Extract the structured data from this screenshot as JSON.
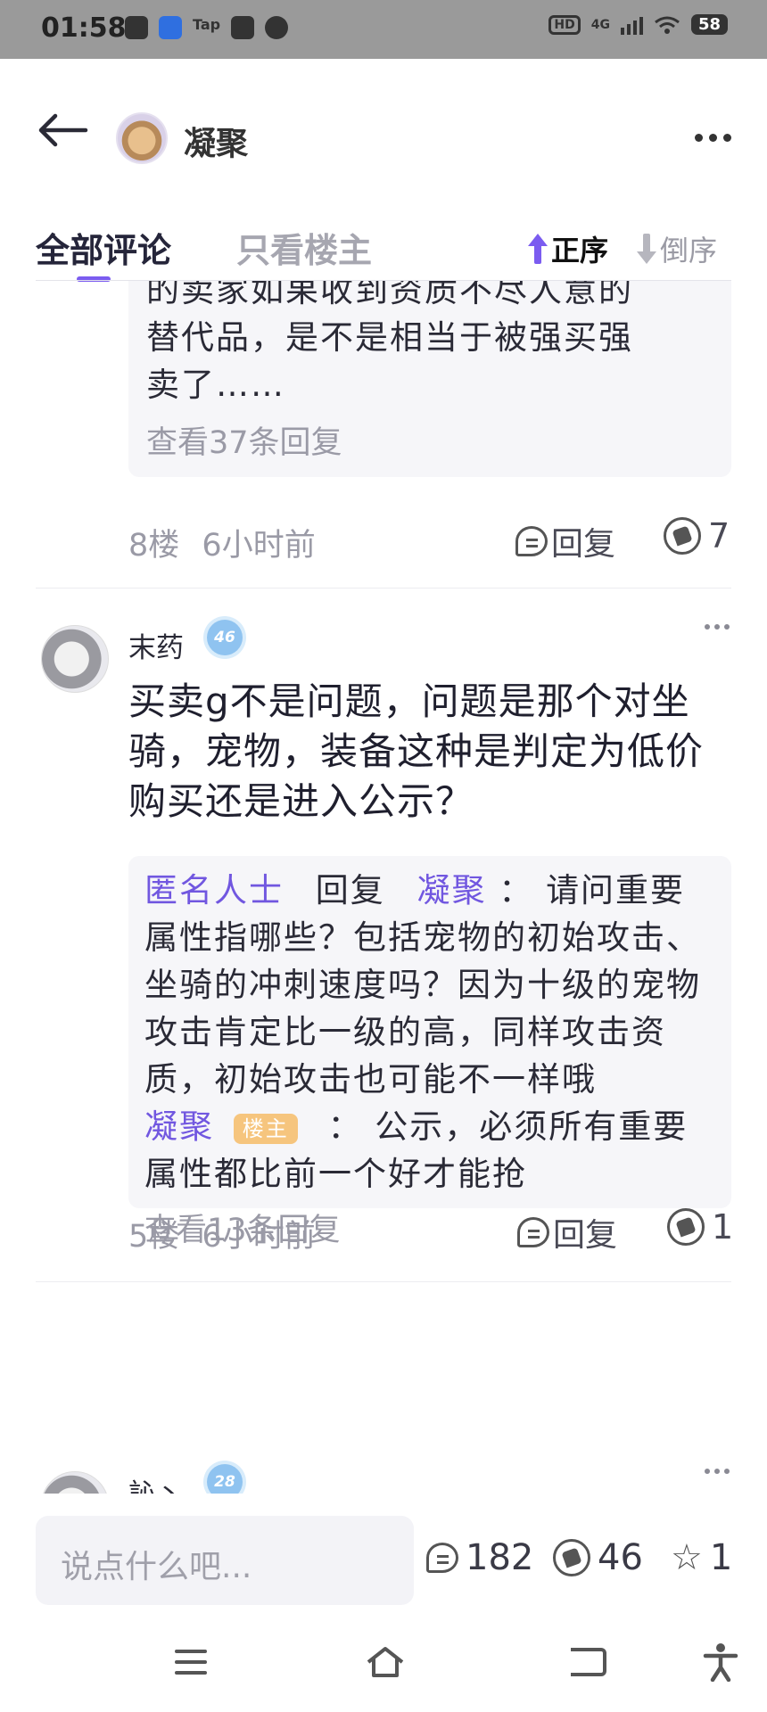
{
  "status_bar": {
    "time": "01:58",
    "tap_label": "Tap",
    "hd_label": "HD",
    "network": "4G",
    "battery": "58"
  },
  "header": {
    "title": "凝聚"
  },
  "tabs": {
    "all": "全部评论",
    "op_only": "只看楼主",
    "sort_asc": "正序",
    "sort_desc": "倒序"
  },
  "floor8": {
    "reply_lines": [
      "的卖家如果收到资质不尽人意的",
      "替代品，是不是相当于被强买强",
      "卖了……"
    ],
    "view_more": "查看37条回复",
    "floor": "8楼",
    "time": "6小时前",
    "reply_label": "回复",
    "likes": "7"
  },
  "floor5": {
    "username": "末药",
    "level": "46",
    "text": "买卖g不是问题，问题是那个对坐骑，宠物，装备这种是判定为低价购买还是进入公示？",
    "reply1_user": "匿名人士",
    "reply1_verb": "回复",
    "reply1_target": "凝聚",
    "reply1_colon": "：",
    "reply1_text": "请问重要属性指哪些？包括宠物的初始攻击、坐骑的冲刺速度吗？因为十级的宠物攻击肯定比一级的高，同样攻击资质，初始攻击也可能不一样哦",
    "reply2_user": "凝聚",
    "reply2_tag": "楼主",
    "reply2_colon": "：",
    "reply2_text": "公示，必须所有重要属性都比前一个好才能抢",
    "view_more": "查看13条回复",
    "floor": "5楼",
    "time": "6小时前",
    "reply_label": "回复",
    "likes": "1"
  },
  "next_comment": {
    "username": "訫丶",
    "level": "28"
  },
  "bottom_bar": {
    "placeholder": "说点什么吧...",
    "comments": "182",
    "likes": "46",
    "favorites": "1"
  }
}
